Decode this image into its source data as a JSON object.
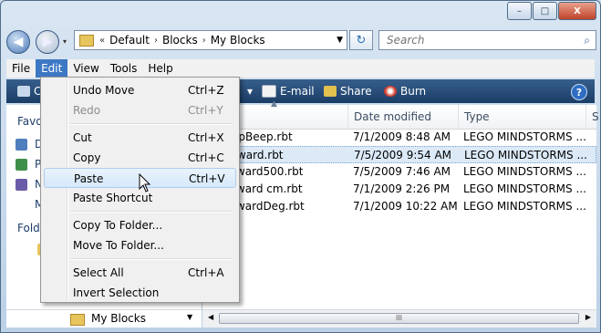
{
  "window": {
    "minimize_glyph": "–",
    "maximize_glyph": "□",
    "close_glyph": "X"
  },
  "nav": {
    "back_glyph": "◀",
    "forward_glyph": "▶",
    "history_glyph": "▾",
    "breadcrumb": [
      "«",
      "Default",
      "Blocks",
      "My Blocks"
    ],
    "refresh_glyph": "↻",
    "search_placeholder": "Search",
    "search_glyph": "⌕"
  },
  "menubar": {
    "items": [
      "File",
      "Edit",
      "View",
      "Tools",
      "Help"
    ],
    "active": "Edit"
  },
  "toolbar": {
    "organize_partial": "C",
    "email_label": "E-mail",
    "share_label": "Share",
    "burn_label": "Burn",
    "help_glyph": "?",
    "colors": {
      "bar_top": "#375f8c",
      "bar_bottom": "#1b3d66"
    }
  },
  "navpane": {
    "favorites_partial": "Favo",
    "fav_items": [
      "D",
      "P",
      "N",
      "M"
    ],
    "folders_partial": "Folde",
    "bottom_folder": "My Blocks"
  },
  "files": {
    "columns": [
      "Date modified",
      "Type",
      "S"
    ],
    "rows": [
      {
        "name": "epBeep.rbt",
        "date": "7/1/2009 8:48 AM",
        "type": "LEGO MINDSTORMS ..."
      },
      {
        "name": "rward.rbt",
        "date": "7/5/2009 9:54 AM",
        "type": "LEGO MINDSTORMS ...",
        "selected": true
      },
      {
        "name": "rward500.rbt",
        "date": "7/5/2009 7:46 AM",
        "type": "LEGO MINDSTORMS ..."
      },
      {
        "name": "rward cm.rbt",
        "date": "7/1/2009 2:26 PM",
        "type": "LEGO MINDSTORMS ..."
      },
      {
        "name": "rwardDeg.rbt",
        "date": "7/1/2009 10:22 AM",
        "type": "LEGO MINDSTORMS ..."
      }
    ],
    "scroll_grip": "III"
  },
  "edit_menu": {
    "items": [
      {
        "label": "Undo Move",
        "shortcut": "Ctrl+Z",
        "enabled": true
      },
      {
        "label": "Redo",
        "shortcut": "Ctrl+Y",
        "enabled": false
      },
      {
        "label": "Cut",
        "shortcut": "Ctrl+X",
        "enabled": true
      },
      {
        "label": "Copy",
        "shortcut": "Ctrl+C",
        "enabled": true
      },
      {
        "label": "Paste",
        "shortcut": "Ctrl+V",
        "enabled": true,
        "hover": true
      },
      {
        "label": "Paste Shortcut",
        "shortcut": "",
        "enabled": true
      },
      {
        "label": "Copy To Folder...",
        "shortcut": "",
        "enabled": true
      },
      {
        "label": "Move To Folder...",
        "shortcut": "",
        "enabled": true
      },
      {
        "label": "Select All",
        "shortcut": "Ctrl+A",
        "enabled": true
      },
      {
        "label": "Invert Selection",
        "shortcut": "",
        "enabled": true
      }
    ]
  }
}
